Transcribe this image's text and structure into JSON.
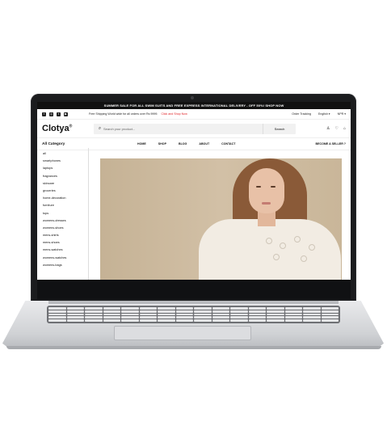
{
  "promo_text": "SUMMER SALE FOR ALL SWIM SUITS AND FREE EXPRESS INTERNATIONAL DELIVERY - OFF 50%! SHOP NOW",
  "topbar": {
    "socials": [
      "facebook-icon",
      "instagram-icon",
      "twitter-icon",
      "youtube-icon"
    ],
    "shipping": "Free Shipping World wide for all orders over Rs 9999.",
    "shipping_link": "Click and Shop Now",
    "order_tracking": "Order Tracking",
    "language": "English ▾",
    "currency": "NPR ▾"
  },
  "header": {
    "logo": "Clotya",
    "logo_mark": "®",
    "search_placeholder": "Search your product...",
    "search_button": "Search",
    "icons": [
      "user-icon",
      "heart-icon",
      "cart-icon"
    ]
  },
  "nav": {
    "all_category": "All Category",
    "items": [
      "HOME",
      "SHOP",
      "BLOG",
      "ABOUT",
      "CONTACT"
    ],
    "seller": "BECOME A SELLER ?"
  },
  "categories": [
    "all",
    "smartphones",
    "laptops",
    "fragrances",
    "skincare",
    "groceries",
    "home-decoration",
    "furniture",
    "tops",
    "womens-dresses",
    "womens-shoes",
    "mens-shirts",
    "mens-shoes",
    "mens-watches",
    "womens-watches",
    "womens-bags"
  ],
  "colors": {
    "promo_bg": "#111111",
    "link_red": "#e0262a",
    "laptop_dark": "#1b1c1e"
  }
}
